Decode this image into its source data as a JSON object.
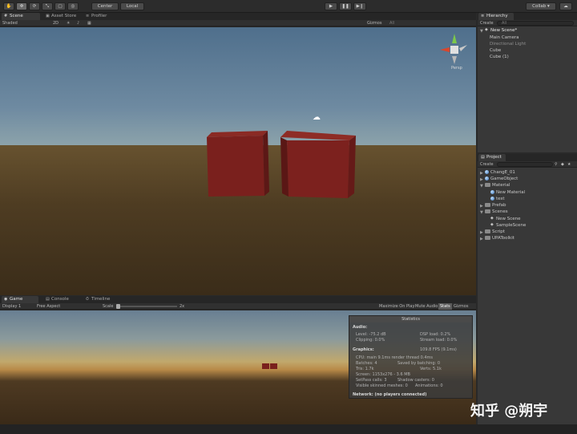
{
  "toolbar": {
    "pivot_label": "Center",
    "space_label": "Local",
    "collab_label": "Collab",
    "play_icon": "play-icon",
    "pause_icon": "pause-icon",
    "step_icon": "step-icon"
  },
  "scene_panel": {
    "tabs": [
      "Scene",
      "Asset Store",
      "Profiler"
    ],
    "shading_mode": "Shaded",
    "toggle_2d": "2D",
    "gizmos_label": "Gizmos",
    "search_text": "All",
    "camera_label": "Persp"
  },
  "game_panel": {
    "tabs": [
      "Game",
      "Console",
      "Timeline"
    ],
    "display": "Display 1",
    "aspect": "Free Aspect",
    "scale_label": "Scale",
    "scale_value": "2x",
    "maximize_label": "Maximize On Play",
    "mute_label": "Mute Audio",
    "stats_label": "Stats",
    "gizmos_label": "Gizmos"
  },
  "stats": {
    "title": "Statistics",
    "audio_header": "Audio:",
    "level": "Level: -75.2 dB",
    "dsp_load": "DSP load: 0.2%",
    "clipping": "Clipping: 0.0%",
    "stream_load": "Stream load: 0.0%",
    "graphics_header": "Graphics:",
    "fps": "109.8 FPS (9.1ms)",
    "cpu": "CPU: main 9.1ms  render thread 0.4ms",
    "batches": "Batches: 4",
    "saved_batching": "Saved by batching: 0",
    "tris": "Tris: 1.7k",
    "verts": "Verts: 5.1k",
    "screen": "Screen: 1153x276 - 3.6 MB",
    "setpass": "SetPass calls: 3",
    "shadow_casters": "Shadow casters: 0",
    "skinned": "Visible skinned meshes: 0",
    "animations": "Animations: 0",
    "network": "Network: (no players connected)"
  },
  "hierarchy": {
    "tab": "Hierarchy",
    "create_label": "Create",
    "search_placeholder": "All",
    "scene_name": "New Scene*",
    "items": [
      "Main Camera",
      "Directional Light",
      "Cube",
      "Cube (1)"
    ]
  },
  "project": {
    "tab": "Project",
    "create_label": "Create",
    "items": [
      {
        "label": "ChangE_01",
        "kind": "prefab"
      },
      {
        "label": "GameObject",
        "kind": "prefab"
      },
      {
        "label": "Material",
        "kind": "folder"
      },
      {
        "label": "New Material",
        "kind": "material"
      },
      {
        "label": "test",
        "kind": "material"
      },
      {
        "label": "Prefab",
        "kind": "folder"
      },
      {
        "label": "Scenes",
        "kind": "folder"
      },
      {
        "label": "New Scene",
        "kind": "scene"
      },
      {
        "label": "SampleScene",
        "kind": "scene"
      },
      {
        "label": "Script",
        "kind": "folder"
      },
      {
        "label": "UPAToolkit",
        "kind": "folder"
      }
    ]
  },
  "watermark": "知乎 @朔宇",
  "colors": {
    "cube": "#7a1f1f",
    "cube_side": "#5a1616",
    "panel_bg": "#383838"
  }
}
